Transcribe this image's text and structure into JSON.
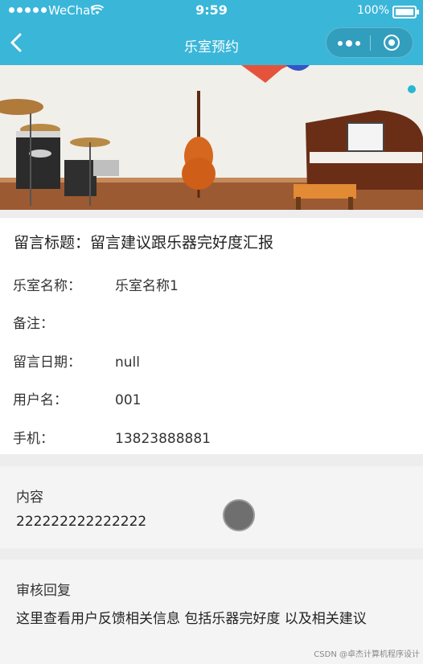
{
  "status_bar": {
    "carrier": "WeChat",
    "time": "9:59",
    "battery": "100%"
  },
  "nav": {
    "title": "乐室预约"
  },
  "detail": {
    "title_label": "留言标题：",
    "title_value": "留言建议跟乐器完好度汇报",
    "rows": [
      {
        "label": "乐室名称：",
        "value": "乐室名称1"
      },
      {
        "label": "备注：",
        "value": ""
      },
      {
        "label": "留言日期：",
        "value": "null"
      },
      {
        "label": "用户名：",
        "value": "001"
      },
      {
        "label": "手机：",
        "value": "13823888881"
      }
    ]
  },
  "content": {
    "heading": "内容",
    "text": "222222222222222"
  },
  "reply": {
    "heading": "审核回复",
    "text": "这里查看用户反馈相关信息 包括乐器完好度 以及相关建议"
  },
  "watermark": "CSDN @卓杰计算机程序设计",
  "colors": {
    "nav_bar": "#3ab6d9",
    "page_bg": "#ededed",
    "card_bg": "#f4f4f4"
  },
  "icons": {
    "back": "chevron-left-icon",
    "more": "more-dots-icon",
    "close": "target-circle-icon"
  }
}
